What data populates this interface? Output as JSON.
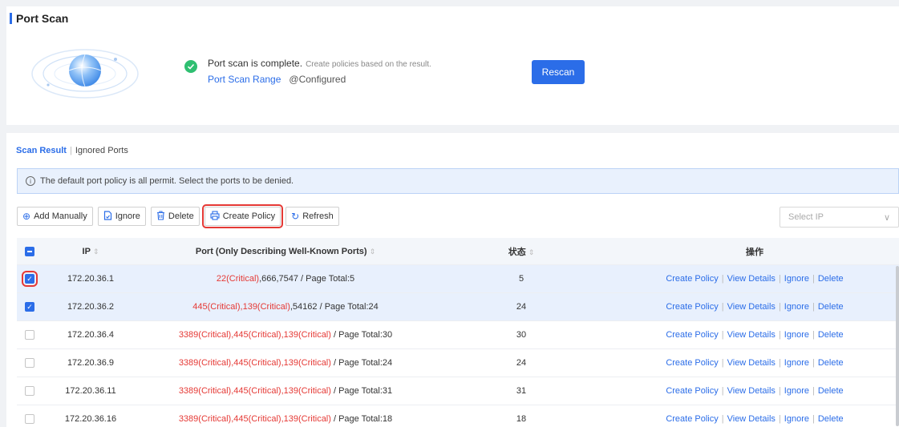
{
  "header": {
    "title": "Port Scan"
  },
  "scan": {
    "status_main": "Port scan is complete.",
    "status_sub": "Create policies based on the result.",
    "range_link": "Port Scan Range",
    "range_status": "@Configured",
    "rescan_label": "Rescan"
  },
  "tabs": {
    "active": "Scan Result",
    "separator": "|",
    "other": "Ignored Ports"
  },
  "notice": {
    "icon": "i",
    "text": "The default port policy is all permit. Select the ports to be denied."
  },
  "toolbar": {
    "add_manually": "Add Manually",
    "ignore": "Ignore",
    "delete": "Delete",
    "create_policy": "Create Policy",
    "refresh": "Refresh"
  },
  "select_ip": {
    "placeholder": "Select IP",
    "chevron": "∨"
  },
  "table": {
    "headers": {
      "ip": "IP",
      "port": "Port (Only Describing Well-Known Ports)",
      "state": "状态",
      "ops": "操作",
      "sort_glyph": "⇕"
    },
    "op_labels": {
      "create": "Create Policy",
      "view": "View Details",
      "ignore": "Ignore",
      "delete": "Delete",
      "sep": "|"
    },
    "rows": [
      {
        "checked": true,
        "ip": "172.20.36.1",
        "crit": "22(Critical)",
        "rest": ",666,7547 / Page Total:5",
        "state": "5"
      },
      {
        "checked": true,
        "ip": "172.20.36.2",
        "crit": "445(Critical),139(Critical)",
        "rest": ",54162 / Page Total:24",
        "state": "24"
      },
      {
        "checked": false,
        "ip": "172.20.36.4",
        "crit": "3389(Critical),445(Critical),139(Critical)",
        "rest": " / Page Total:30",
        "state": "30"
      },
      {
        "checked": false,
        "ip": "172.20.36.9",
        "crit": "3389(Critical),445(Critical),139(Critical)",
        "rest": " / Page Total:24",
        "state": "24"
      },
      {
        "checked": false,
        "ip": "172.20.36.11",
        "crit": "3389(Critical),445(Critical),139(Critical)",
        "rest": " / Page Total:31",
        "state": "31"
      },
      {
        "checked": false,
        "ip": "172.20.36.16",
        "crit": "3389(Critical),445(Critical),139(Critical)",
        "rest": " / Page Total:18",
        "state": "18"
      }
    ]
  },
  "colors": {
    "accent": "#2b6de8",
    "critical": "#e53935",
    "success": "#2fbf71",
    "highlight": "#e53935"
  }
}
